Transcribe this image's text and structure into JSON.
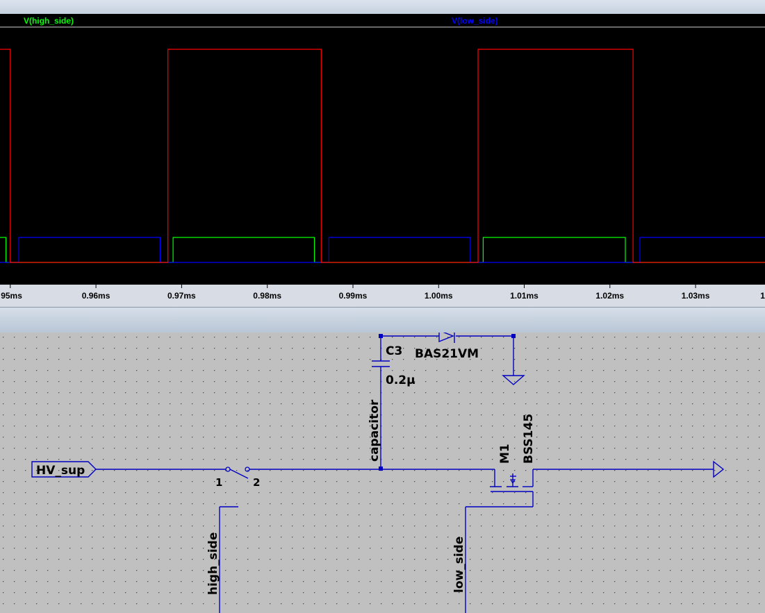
{
  "waveform": {
    "traces": [
      {
        "name": "V(high_side)",
        "color": "#00ff00"
      },
      {
        "name": "V(low_side)",
        "color": "#0000ff"
      }
    ],
    "third_trace_color": "#ff0000",
    "background": "#000000"
  },
  "chart_data": {
    "type": "line",
    "x_unit": "ms",
    "xlim": [
      0.9488,
      1.0381
    ],
    "tick_labels": [
      "95ms",
      "0.96ms",
      "0.97ms",
      "0.98ms",
      "0.99ms",
      "1.00ms",
      "1.01ms",
      "1.02ms",
      "1.03ms",
      "1"
    ],
    "tick_values": [
      0.95,
      0.96,
      0.97,
      0.98,
      0.99,
      1.0,
      1.01,
      1.02,
      1.03,
      1.04
    ],
    "grid": false,
    "legend": "top",
    "series": [
      {
        "name": "V(high_side)",
        "color": "#00ff00",
        "level": "low",
        "high_intervals": [
          [
            0.9488,
            0.9495
          ],
          [
            0.969,
            0.9855
          ],
          [
            1.0052,
            1.0218
          ]
        ]
      },
      {
        "name": "V(low_side)",
        "color": "#0000ff",
        "level": "low",
        "high_intervals": [
          [
            0.951,
            0.9675
          ],
          [
            0.9872,
            1.0037
          ],
          [
            1.0235,
            1.0381
          ]
        ]
      },
      {
        "name": "",
        "color": "#ff0000",
        "level": "high",
        "high_intervals": [
          [
            0.9488,
            0.95
          ],
          [
            0.9684,
            0.9863
          ],
          [
            1.0046,
            1.0227
          ]
        ]
      }
    ]
  },
  "schematic": {
    "capacitor_name": "C3",
    "capacitor_value": "0.2µ",
    "diode_model": "BAS21VM",
    "mosfet_name": "M1",
    "mosfet_model": "BSS145",
    "net_capacitor": "capacitor",
    "net_high_side": "high_side",
    "net_low_side": "low_side",
    "port_hv": "HV_sup",
    "switch_pin1": "1",
    "switch_pin2": "2",
    "wire_color": "#0000c0"
  }
}
